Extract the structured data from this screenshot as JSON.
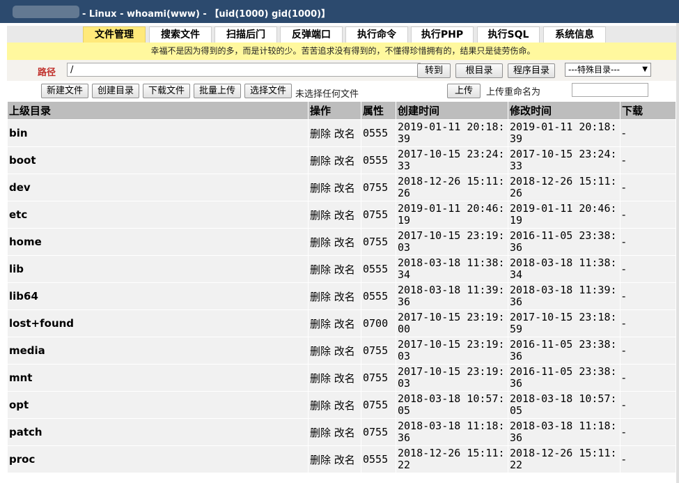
{
  "title": "- Linux - whoami(www) - 【uid(1000) gid(1000)】",
  "tabs": [
    "文件管理",
    "搜索文件",
    "扫描后门",
    "反弹端口",
    "执行命令",
    "执行PHP",
    "执行SQL",
    "系统信息"
  ],
  "motto": "幸福不是因为得到的多，而是计较的少。苦苦追求没有得到的，不懂得珍惜拥有的，结果只是徒劳伤命。",
  "path": {
    "label": "路径",
    "value": "/",
    "goto": "转到",
    "root": "根目录",
    "program": "程序目录",
    "special": "---特殊目录---"
  },
  "toolbar": {
    "new_file": "新建文件",
    "new_dir": "创建目录",
    "download": "下载文件",
    "batch_upload": "批量上传",
    "choose_file": "选择文件",
    "no_file": "未选择任何文件",
    "upload": "上传",
    "rename_label": "上传重命名为"
  },
  "columns": [
    "上级目录",
    "操作",
    "属性",
    "创建时间",
    "修改时间",
    "下载"
  ],
  "ops": {
    "delete": "删除",
    "rename": "改名"
  },
  "rows": [
    {
      "name": "bin",
      "perm": "0555",
      "ctime": "2019-01-11 20:18:39",
      "mtime": "2019-01-11 20:18:39",
      "dl": "-"
    },
    {
      "name": "boot",
      "perm": "0555",
      "ctime": "2017-10-15 23:24:33",
      "mtime": "2017-10-15 23:24:33",
      "dl": "-"
    },
    {
      "name": "dev",
      "perm": "0755",
      "ctime": "2018-12-26 15:11:26",
      "mtime": "2018-12-26 15:11:26",
      "dl": "-"
    },
    {
      "name": "etc",
      "perm": "0755",
      "ctime": "2019-01-11 20:46:19",
      "mtime": "2019-01-11 20:46:19",
      "dl": "-"
    },
    {
      "name": "home",
      "perm": "0755",
      "ctime": "2017-10-15 23:19:03",
      "mtime": "2016-11-05 23:38:36",
      "dl": "-"
    },
    {
      "name": "lib",
      "perm": "0555",
      "ctime": "2018-03-18 11:38:34",
      "mtime": "2018-03-18 11:38:34",
      "dl": "-"
    },
    {
      "name": "lib64",
      "perm": "0555",
      "ctime": "2018-03-18 11:39:36",
      "mtime": "2018-03-18 11:39:36",
      "dl": "-"
    },
    {
      "name": "lost+found",
      "perm": "0700",
      "ctime": "2017-10-15 23:19:00",
      "mtime": "2017-10-15 23:18:59",
      "dl": "-"
    },
    {
      "name": "media",
      "perm": "0755",
      "ctime": "2017-10-15 23:19:03",
      "mtime": "2016-11-05 23:38:36",
      "dl": "-"
    },
    {
      "name": "mnt",
      "perm": "0755",
      "ctime": "2017-10-15 23:19:03",
      "mtime": "2016-11-05 23:38:36",
      "dl": "-"
    },
    {
      "name": "opt",
      "perm": "0755",
      "ctime": "2018-03-18 10:57:05",
      "mtime": "2018-03-18 10:57:05",
      "dl": "-"
    },
    {
      "name": "patch",
      "perm": "0755",
      "ctime": "2018-03-18 11:18:36",
      "mtime": "2018-03-18 11:18:36",
      "dl": "-"
    },
    {
      "name": "proc",
      "perm": "0555",
      "ctime": "2018-12-26 15:11:22",
      "mtime": "2018-12-26 15:11:22",
      "dl": "-"
    }
  ],
  "colors": {
    "title_bg": "#2c4a6e",
    "active_tab": "#ffe97a",
    "motto_bg": "#fff89e",
    "path_label": "#c0302b",
    "header_bg": "#bdbdbd",
    "row_bg": "#f1f1f1"
  }
}
